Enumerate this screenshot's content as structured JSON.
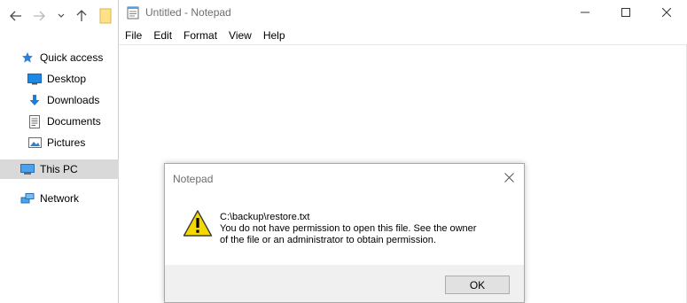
{
  "explorer": {
    "toolbar": {
      "back_icon": "arrow-left-icon",
      "forward_icon": "arrow-right-icon",
      "recent_icon": "chevron-down-icon",
      "up_icon": "arrow-up-icon",
      "folder_icon": "folder-icon"
    },
    "nav": {
      "items": [
        {
          "label": "Quick access",
          "icon": "star-icon"
        },
        {
          "label": "Desktop",
          "icon": "desktop-icon"
        },
        {
          "label": "Downloads",
          "icon": "download-arrow-icon"
        },
        {
          "label": "Documents",
          "icon": "document-icon"
        },
        {
          "label": "Pictures",
          "icon": "picture-icon"
        },
        {
          "label": "This PC",
          "icon": "computer-icon",
          "selected": true
        },
        {
          "label": "Network",
          "icon": "network-icon"
        }
      ]
    }
  },
  "notepad": {
    "title": "Untitled - Notepad",
    "menu": [
      "File",
      "Edit",
      "Format",
      "View",
      "Help"
    ],
    "window_controls": [
      "minimize-icon",
      "maximize-icon",
      "close-icon"
    ]
  },
  "dialog": {
    "title": "Notepad",
    "icon": "warning-icon",
    "message": {
      "line1": "C:\\backup\\restore.txt",
      "line2": "You do not have permission to open this file.  See the owner",
      "line3": "of the file or an administrator to obtain permission."
    },
    "ok_label": "OK"
  },
  "colors": {
    "selection": "#d9d9d9",
    "accent_blue": "#1e7bd6",
    "warning_yellow": "#f5d800",
    "footer_bg": "#f0f0f0"
  }
}
